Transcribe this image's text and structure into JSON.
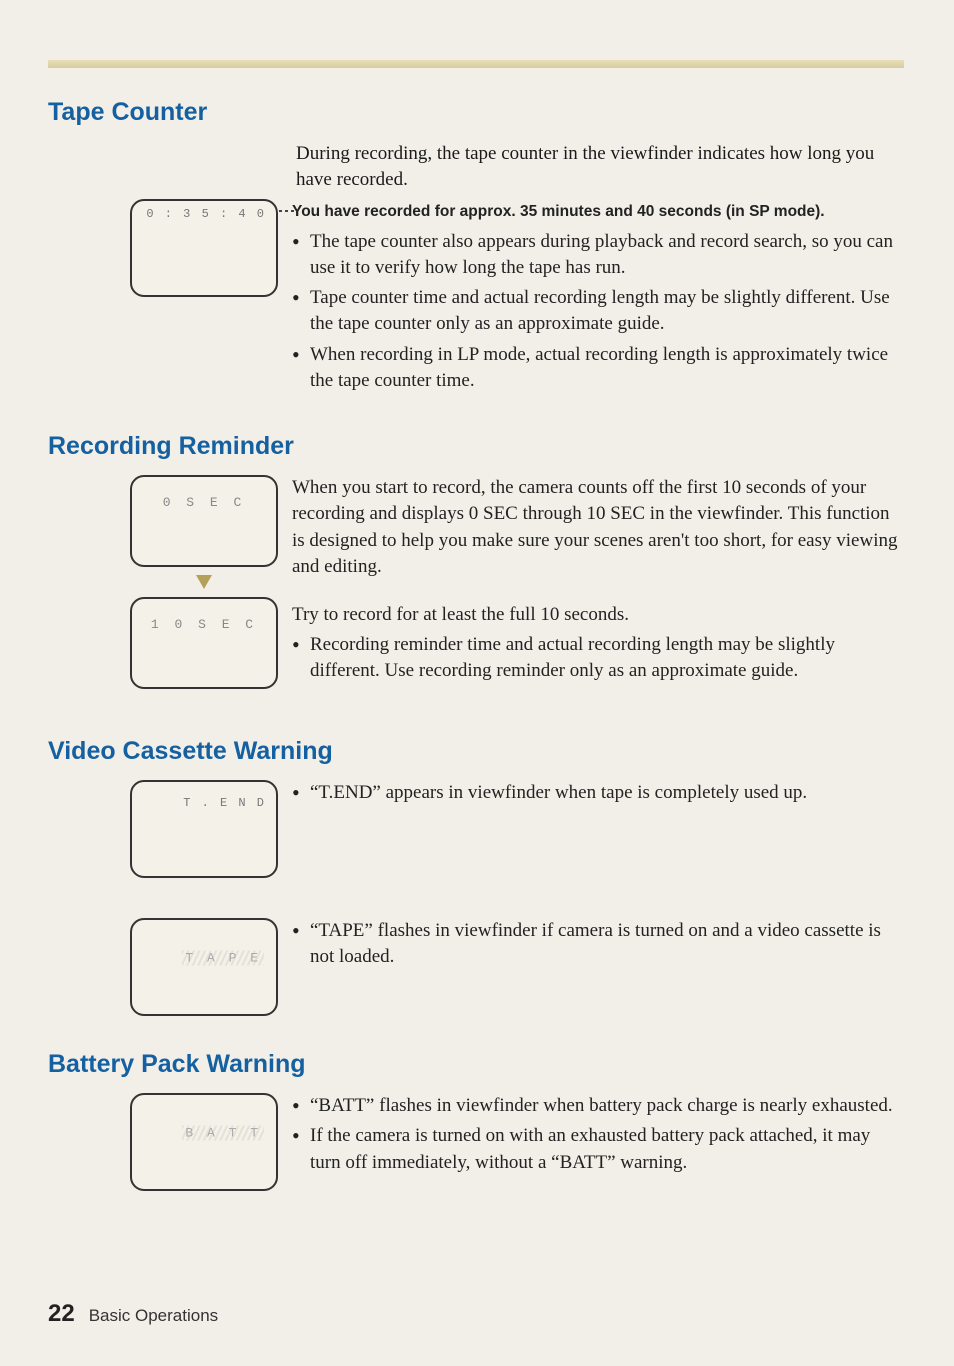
{
  "sections": {
    "tape_counter": {
      "heading": "Tape Counter",
      "intro": "During recording, the tape counter in the viewfinder indicates how long you have recorded.",
      "viewfinder_display": "0 : 3 5 : 4 0",
      "bold_note": "You have recorded for approx. 35 minutes and 40 seconds (in SP mode).",
      "bullets": [
        "The tape counter also appears during playback and record search, so you can use it to verify how long the tape has run.",
        "Tape counter time and actual recording length may be slightly different. Use the tape counter only as an approximate guide.",
        "When recording in LP mode, actual recording length is approximately twice the tape counter time."
      ]
    },
    "recording_reminder": {
      "heading": "Recording Reminder",
      "viewfinder_display_top": "0  S E C",
      "viewfinder_display_bottom": "1 0  S E C",
      "intro": "When you start to record, the camera counts off the first 10 seconds of your recording and displays 0 SEC through 10 SEC in the viewfinder. This function is designed to help you make sure your scenes aren't too short, for easy viewing and editing.",
      "try_note": "Try to record for at least the full 10 seconds.",
      "bullets": [
        "Recording reminder time and actual recording length may be slightly different. Use recording reminder only as an approximate guide."
      ]
    },
    "video_cassette_warning": {
      "heading": "Video Cassette Warning",
      "box1_display": "T . E N D",
      "box1_bullet": "“T.END” appears in viewfinder when tape is completely used up.",
      "box2_display": "T A P E",
      "box2_bullet": "“TAPE” flashes in viewfinder if camera is turned on and a video cassette is not loaded."
    },
    "battery_pack_warning": {
      "heading": "Battery Pack Warning",
      "box_display": "B A T T",
      "bullets": [
        "“BATT” flashes in viewfinder when battery pack charge is nearly exhausted.",
        "If the camera is turned on with an exhausted battery pack attached, it may turn off immediately, without a “BATT” warning."
      ]
    }
  },
  "footer": {
    "page_number": "22",
    "section_label": "Basic Operations"
  }
}
